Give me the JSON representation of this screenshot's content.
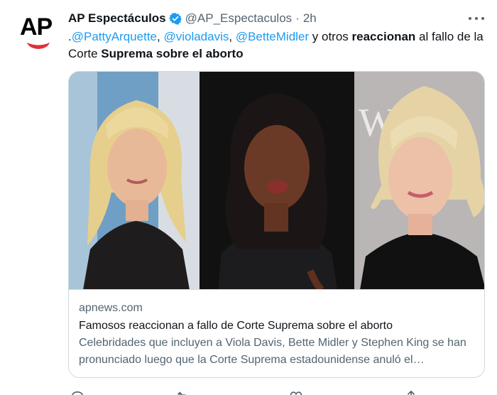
{
  "tweet": {
    "display_name": "AP Espectáculos",
    "handle": "@AP_Espectaculos",
    "separator": "·",
    "time": "2h",
    "avatar_text": "AP",
    "text": {
      "lead": ".",
      "mention1": "@PattyArquette",
      "sep1": ", ",
      "mention2": "@violadavis",
      "sep2": ", ",
      "mention3": "@BetteMidler",
      "plain1": " y otros ",
      "bold1": "reaccionan",
      "plain2": " al fallo de la Corte ",
      "bold2": "Suprema",
      "bold3": " sobre el aborto"
    }
  },
  "card": {
    "domain": "apnews.com",
    "title": "Famosos reaccionan a fallo de Corte Suprema sobre el aborto",
    "description": "Celebridades que incluyen a Viola Davis, Bette Midler y Stephen King se han pronunciado luego que la Corte Suprema estadounidense anuló el…",
    "backdrop_text": "WS"
  },
  "colors": {
    "link": "#1d9bf0",
    "verified": "#1d9bf0",
    "ap_red": "#e0303a",
    "muted": "#536471",
    "border": "#cfd9de"
  },
  "icons": {
    "verified": "verified-badge-icon",
    "more": "more-options-icon",
    "reply": "reply-icon",
    "retweet": "retweet-icon",
    "like": "like-icon",
    "share": "share-icon"
  }
}
